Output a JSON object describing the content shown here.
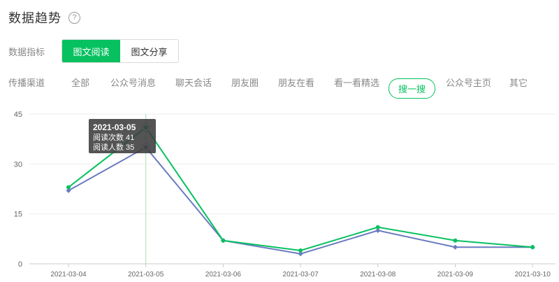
{
  "header": {
    "title": "数据趋势",
    "help_icon": "?"
  },
  "metrics": {
    "label": "数据指标",
    "options": [
      "图文阅读",
      "图文分享"
    ],
    "active": 0
  },
  "channels": {
    "label": "传播渠道",
    "tabs": [
      "全部",
      "公众号消息",
      "聊天会话",
      "朋友圈",
      "朋友在看",
      "看一看精选",
      "搜一搜",
      "公众号主页",
      "其它"
    ],
    "active": 6
  },
  "colors": {
    "accent": "#07c160",
    "series1": "#07c160",
    "series2": "#6a7bbf"
  },
  "chart_data": {
    "type": "line",
    "x": [
      "2021-03-04",
      "2021-03-05",
      "2021-03-06",
      "2021-03-07",
      "2021-03-08",
      "2021-03-09",
      "2021-03-10"
    ],
    "y_ticks": [
      0,
      15,
      30,
      45
    ],
    "ylim": [
      0,
      45
    ],
    "series": [
      {
        "name": "阅读次数",
        "values": [
          23,
          41,
          7,
          4,
          11,
          7,
          5
        ]
      },
      {
        "name": "阅读人数",
        "values": [
          22,
          35,
          7,
          3,
          10,
          5,
          5
        ]
      }
    ],
    "hover_index": 1,
    "grid": true
  },
  "tooltip": {
    "date": "2021-03-05",
    "line1": "阅读次数 41",
    "line2": "阅读人数 35"
  }
}
